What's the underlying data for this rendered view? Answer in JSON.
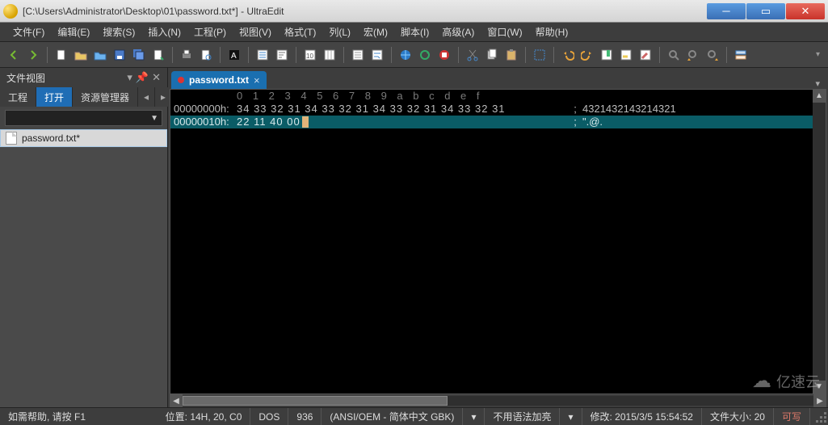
{
  "window": {
    "title": "[C:\\Users\\Administrator\\Desktop\\01\\password.txt*] - UltraEdit"
  },
  "menu": {
    "items": [
      "文件(F)",
      "编辑(E)",
      "搜索(S)",
      "插入(N)",
      "工程(P)",
      "视图(V)",
      "格式(T)",
      "列(L)",
      "宏(M)",
      "脚本(I)",
      "高级(A)",
      "窗口(W)",
      "帮助(H)"
    ]
  },
  "sidebar": {
    "title": "文件视图",
    "tabs": [
      "工程",
      "打开",
      "资源管理器"
    ],
    "active_tab": 1,
    "file": "password.txt*"
  },
  "editor": {
    "tab": {
      "label": "password.txt",
      "modified": true
    },
    "ruler": "0 1 2 3 4 5 6 7 8 9 a b c d e f",
    "lines": [
      {
        "addr": "00000000h:",
        "bytes": "34 33 32 31 34 33 32 31 34 33 32 31 34 33 32 31",
        "sep": ";",
        "ascii": "4321432143214321"
      },
      {
        "addr": "00000010h:",
        "bytes": "22 11 40 00",
        "sep": ";",
        "ascii": "\".@."
      }
    ]
  },
  "status": {
    "help": "如需帮助, 请按 F1",
    "pos": "位置: 14H, 20, C0",
    "mode": "DOS",
    "codepage": "936",
    "encoding": "(ANSI/OEM - 简体中文 GBK)",
    "syntax": "不用语法加亮",
    "modified": "修改: 2015/3/5 15:54:52",
    "filesize": "文件大小: 20",
    "rw": "可写"
  },
  "watermark": "亿速云"
}
